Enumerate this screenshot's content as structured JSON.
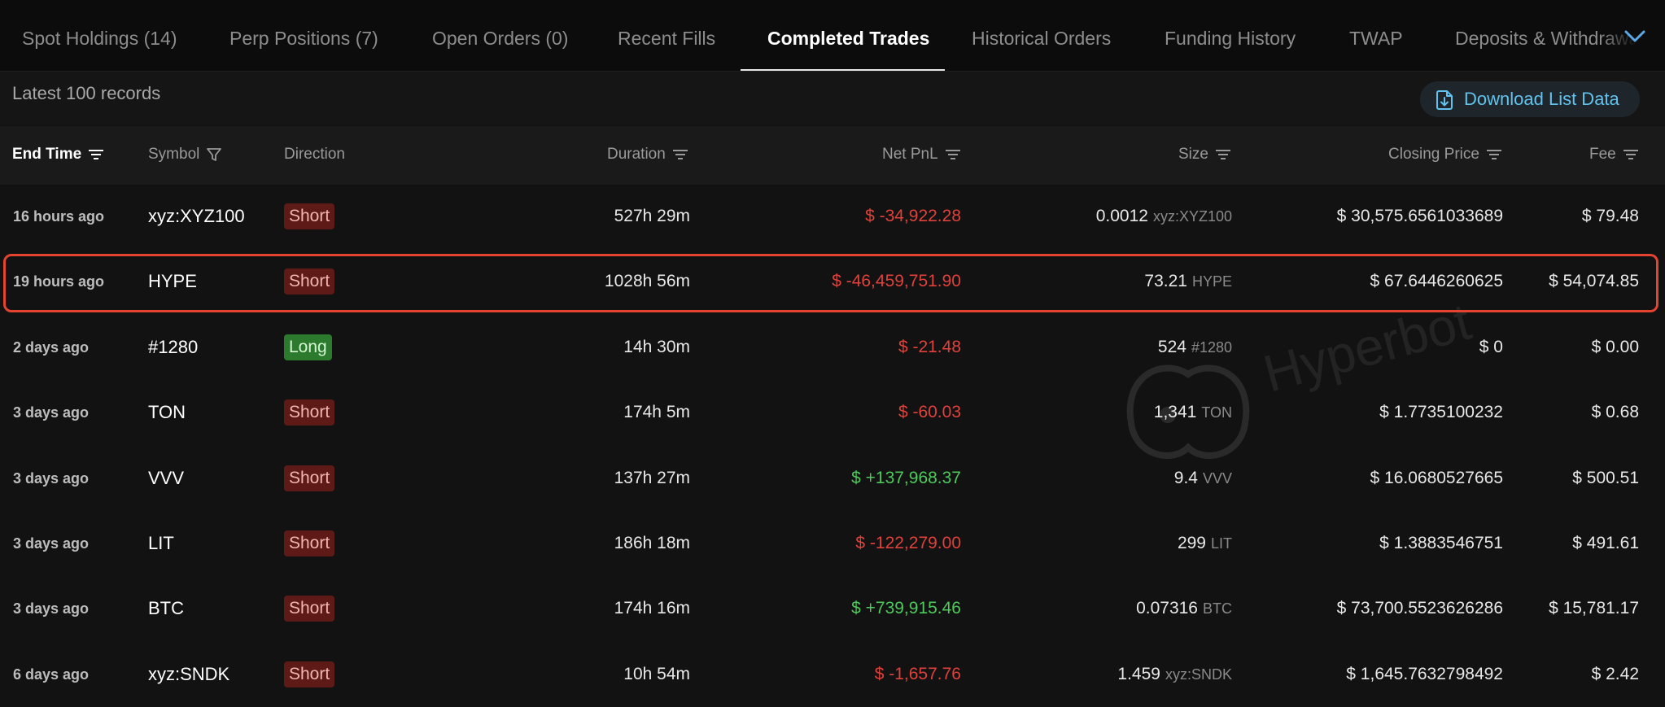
{
  "tabs": [
    {
      "label": "Spot Holdings (14)",
      "active": false
    },
    {
      "label": "Perp Positions (7)",
      "active": false
    },
    {
      "label": "Open Orders (0)",
      "active": false
    },
    {
      "label": "Recent Fills",
      "active": false
    },
    {
      "label": "Completed Trades",
      "active": true
    },
    {
      "label": "Historical Orders",
      "active": false
    },
    {
      "label": "Funding History",
      "active": false
    },
    {
      "label": "TWAP",
      "active": false
    },
    {
      "label": "Deposits & Withdrawals",
      "active": false
    }
  ],
  "toolbar": {
    "records_label": "Latest 100 records",
    "download_label": "Download List Data"
  },
  "watermark": "Hyperbot",
  "table": {
    "columns": {
      "end_time": "End Time",
      "symbol": "Symbol",
      "direction": "Direction",
      "duration": "Duration",
      "net_pnl": "Net PnL",
      "size": "Size",
      "closing_price": "Closing Price",
      "fee": "Fee"
    },
    "highlighted_row": 1,
    "rows": [
      {
        "end_time": "16 hours ago",
        "symbol": "xyz:XYZ100",
        "direction": "Short",
        "duration": "527h 29m",
        "net_pnl": "$ -34,922.28",
        "pnl_sign": "neg",
        "size": "0.0012",
        "size_unit": "xyz:XYZ100",
        "closing_price": "$ 30,575.6561033689",
        "fee": "$ 79.48"
      },
      {
        "end_time": "19 hours ago",
        "symbol": "HYPE",
        "direction": "Short",
        "duration": "1028h 56m",
        "net_pnl": "$ -46,459,751.90",
        "pnl_sign": "neg",
        "size": "73.21",
        "size_unit": "HYPE",
        "closing_price": "$ 67.6446260625",
        "fee": "$ 54,074.85"
      },
      {
        "end_time": "2 days ago",
        "symbol": "#1280",
        "direction": "Long",
        "duration": "14h 30m",
        "net_pnl": "$ -21.48",
        "pnl_sign": "neg",
        "size": "524",
        "size_unit": "#1280",
        "closing_price": "$ 0",
        "fee": "$ 0.00"
      },
      {
        "end_time": "3 days ago",
        "symbol": "TON",
        "direction": "Short",
        "duration": "174h 5m",
        "net_pnl": "$ -60.03",
        "pnl_sign": "neg",
        "size": "1,341",
        "size_unit": "TON",
        "closing_price": "$ 1.7735100232",
        "fee": "$ 0.68"
      },
      {
        "end_time": "3 days ago",
        "symbol": "VVV",
        "direction": "Short",
        "duration": "137h 27m",
        "net_pnl": "$ +137,968.37",
        "pnl_sign": "pos",
        "size": "9.4",
        "size_unit": "VVV",
        "closing_price": "$ 16.0680527665",
        "fee": "$ 500.51"
      },
      {
        "end_time": "3 days ago",
        "symbol": "LIT",
        "direction": "Short",
        "duration": "186h 18m",
        "net_pnl": "$ -122,279.00",
        "pnl_sign": "neg",
        "size": "299",
        "size_unit": "LIT",
        "closing_price": "$ 1.3883546751",
        "fee": "$ 491.61"
      },
      {
        "end_time": "3 days ago",
        "symbol": "BTC",
        "direction": "Short",
        "duration": "174h 16m",
        "net_pnl": "$ +739,915.46",
        "pnl_sign": "pos",
        "size": "0.07316",
        "size_unit": "BTC",
        "closing_price": "$ 73,700.5523626286",
        "fee": "$ 15,781.17"
      },
      {
        "end_time": "6 days ago",
        "symbol": "xyz:SNDK",
        "direction": "Short",
        "duration": "10h 54m",
        "net_pnl": "$ -1,657.76",
        "pnl_sign": "neg",
        "size": "1.459",
        "size_unit": "xyz:SNDK",
        "closing_price": "$ 1,645.7632798492",
        "fee": "$ 2.42"
      }
    ]
  },
  "colors": {
    "negative": "#e0413b",
    "positive": "#4ec95c",
    "short_badge": "#5e1a17",
    "long_badge": "#2b7a2e",
    "accent": "#61c3ee",
    "highlight_border": "#e3432f"
  }
}
